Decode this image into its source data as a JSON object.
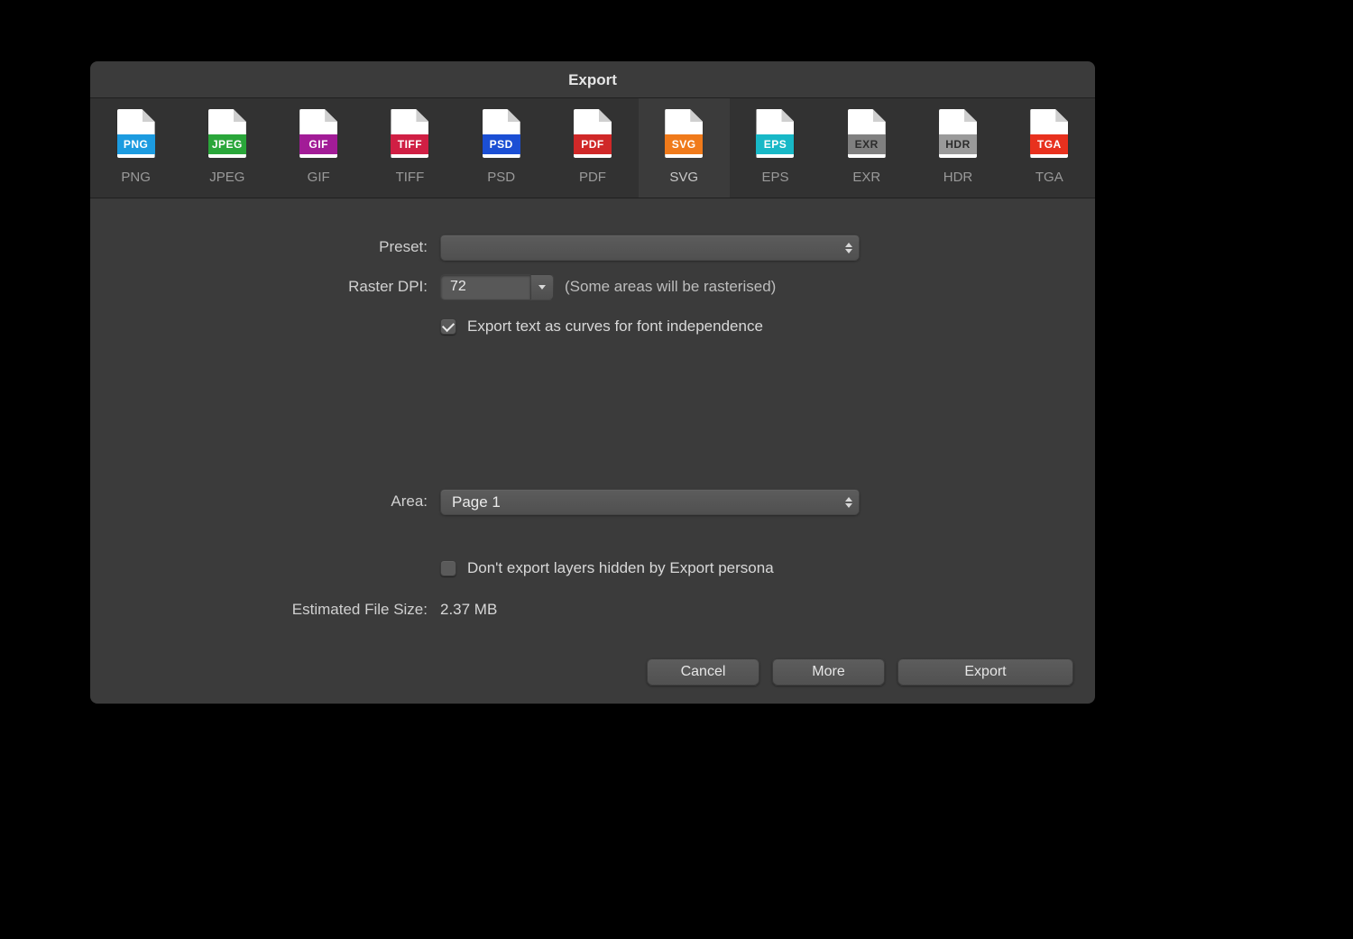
{
  "title": "Export",
  "formats": [
    {
      "label": "PNG",
      "band": "PNG",
      "color": "#1c9be0",
      "txt": "#ffffff"
    },
    {
      "label": "JPEG",
      "band": "JPEG",
      "color": "#2aa63a",
      "txt": "#ffffff"
    },
    {
      "label": "GIF",
      "band": "GIF",
      "color": "#a21c97",
      "txt": "#ffffff"
    },
    {
      "label": "TIFF",
      "band": "TIFF",
      "color": "#d01f44",
      "txt": "#ffffff"
    },
    {
      "label": "PSD",
      "band": "PSD",
      "color": "#1b4fd4",
      "txt": "#ffffff"
    },
    {
      "label": "PDF",
      "band": "PDF",
      "color": "#d02828",
      "txt": "#ffffff"
    },
    {
      "label": "SVG",
      "band": "SVG",
      "color": "#f07a1a",
      "txt": "#ffffff"
    },
    {
      "label": "EPS",
      "band": "EPS",
      "color": "#18b8c7",
      "txt": "#ffffff"
    },
    {
      "label": "EXR",
      "band": "EXR",
      "color": "#808080",
      "txt": "#2c2c2c"
    },
    {
      "label": "HDR",
      "band": "HDR",
      "color": "#9a9a9a",
      "txt": "#2c2c2c"
    },
    {
      "label": "TGA",
      "band": "TGA",
      "color": "#e8311e",
      "txt": "#ffffff"
    }
  ],
  "selected_format_index": 6,
  "labels": {
    "preset": "Preset:",
    "raster_dpi": "Raster DPI:",
    "area": "Area:",
    "estimated": "Estimated File Size:"
  },
  "values": {
    "preset": "",
    "raster_dpi": "72",
    "raster_hint": "(Some areas will be rasterised)",
    "text_as_curves_checked": true,
    "text_as_curves_label": "Export text as curves for font independence",
    "area": "Page 1",
    "hide_layers_checked": false,
    "hide_layers_label": "Don't export layers hidden by Export persona",
    "estimated_size": "2.37 MB"
  },
  "buttons": {
    "cancel": "Cancel",
    "more": "More",
    "export": "Export"
  }
}
